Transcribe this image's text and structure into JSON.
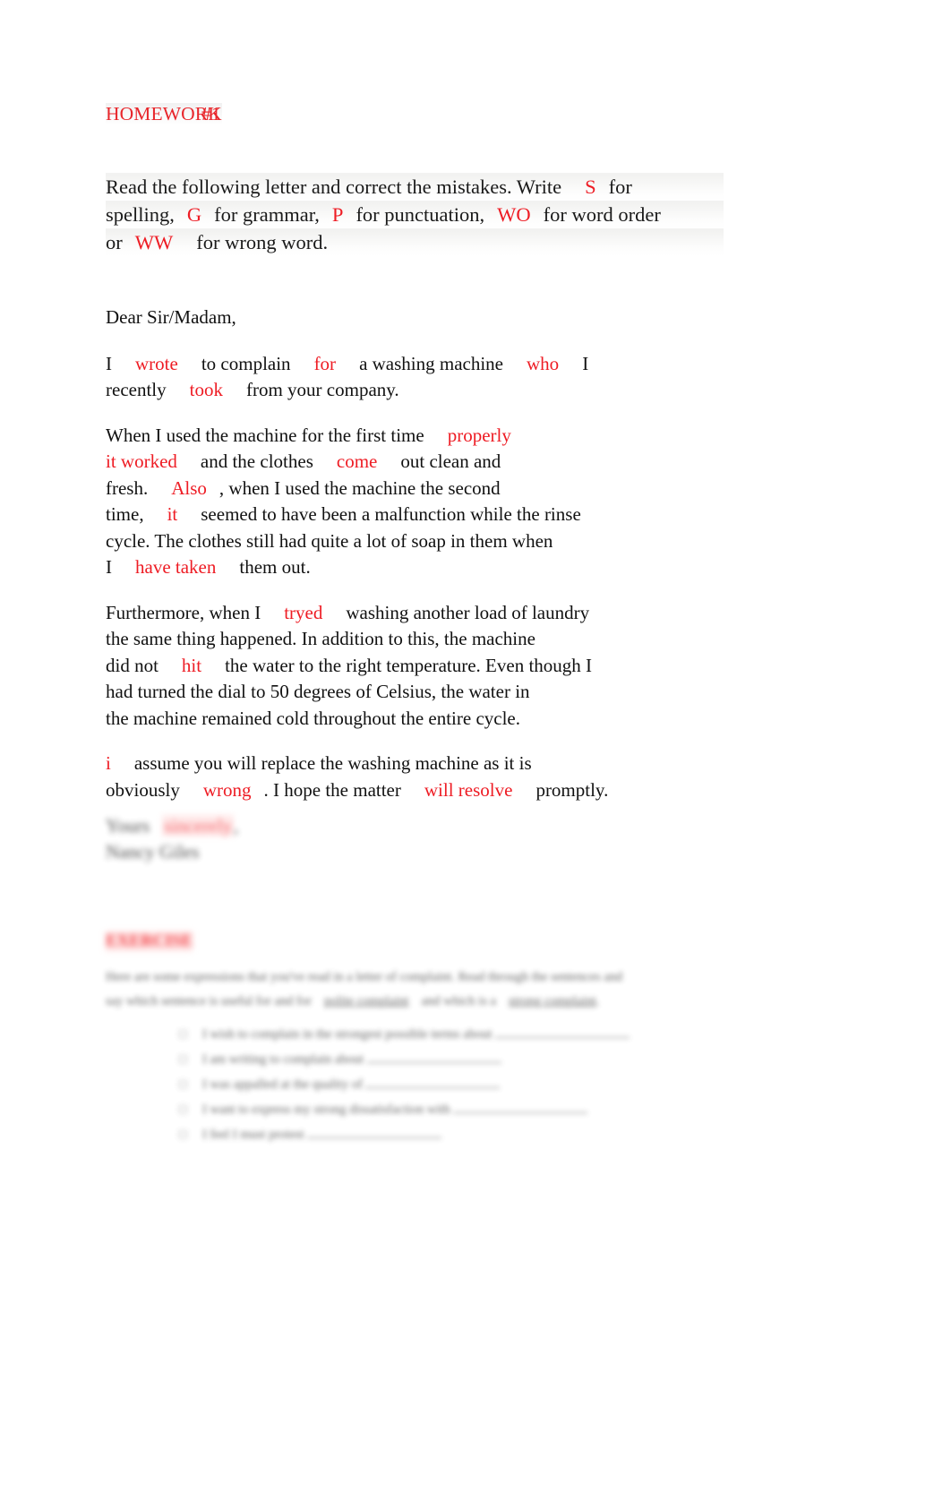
{
  "document": {
    "title_main": "HOMEWORK",
    "title_number": "#1",
    "instructions": {
      "line1_a": "Read the following letter and correct the mistakes. Write",
      "line1_code": "S",
      "line1_b": "for",
      "line2_a": "spelling,",
      "line2_code1": "G",
      "line2_b": "for grammar,",
      "line2_code2": "P",
      "line2_c": "for punctuation,",
      "line2_code3": "WO",
      "line2_d": "for word order",
      "line3_a": "or",
      "line3_code": "WW",
      "line3_b": "for wrong word."
    },
    "salutation": "Dear Sir/Madam,",
    "paragraphs": [
      {
        "id": "p1",
        "lines": [
          [
            {
              "t": "I",
              "c": "black"
            },
            {
              "t": "wrote",
              "c": "red"
            },
            {
              "t": "to complain",
              "c": "black"
            },
            {
              "t": "for",
              "c": "red"
            },
            {
              "t": "a washing machine",
              "c": "black"
            },
            {
              "t": "who",
              "c": "red"
            },
            {
              "t": "I",
              "c": "black"
            }
          ],
          [
            {
              "t": "recently",
              "c": "black"
            },
            {
              "t": "took",
              "c": "red"
            },
            {
              "t": "from your company.",
              "c": "black"
            }
          ]
        ]
      },
      {
        "id": "p2",
        "lines": [
          [
            {
              "t": "When I used the machine for the first time",
              "c": "black"
            },
            {
              "t": "properly",
              "c": "red"
            }
          ],
          [
            {
              "t": "it worked",
              "c": "red"
            },
            {
              "t": "and the clothes",
              "c": "black"
            },
            {
              "t": "come",
              "c": "red"
            },
            {
              "t": "out clean and",
              "c": "black"
            }
          ],
          [
            {
              "t": "fresh.",
              "c": "black"
            },
            {
              "t": "Also",
              "c": "red"
            },
            {
              "t": ", when I used the machine the second",
              "c": "black"
            }
          ],
          [
            {
              "t": "time,",
              "c": "black"
            },
            {
              "t": "it",
              "c": "red"
            },
            {
              "t": "seemed to have been a malfunction while the rinse",
              "c": "black"
            }
          ],
          [
            {
              "t": "cycle. The clothes still had quite a lot of soap in them when",
              "c": "black"
            }
          ],
          [
            {
              "t": "I",
              "c": "black"
            },
            {
              "t": "have taken",
              "c": "red"
            },
            {
              "t": "them out.",
              "c": "black"
            }
          ]
        ]
      },
      {
        "id": "p3",
        "lines": [
          [
            {
              "t": "Furthermore, when I",
              "c": "black"
            },
            {
              "t": "tryed",
              "c": "red"
            },
            {
              "t": "washing another load of laundry",
              "c": "black"
            }
          ],
          [
            {
              "t": "the same thing happened. In addition to this, the machine",
              "c": "black"
            }
          ],
          [
            {
              "t": "did not",
              "c": "black"
            },
            {
              "t": "hit",
              "c": "red"
            },
            {
              "t": "the water to the right temperature. Even though I",
              "c": "black"
            }
          ],
          [
            {
              "t": "had turned the dial to 50 degrees of Celsius, the water in",
              "c": "black"
            }
          ],
          [
            {
              "t": "the machine remained cold throughout the entire cycle.",
              "c": "black"
            }
          ]
        ]
      },
      {
        "id": "p4",
        "lines": [
          [
            {
              "t": "i",
              "c": "red"
            },
            {
              "t": "assume you will replace the washing machine as it is",
              "c": "black"
            }
          ],
          [
            {
              "t": "obviously",
              "c": "black"
            },
            {
              "t": "wrong",
              "c": "red"
            },
            {
              "t": ". I hope the matter",
              "c": "black"
            },
            {
              "t": "will resolve",
              "c": "red"
            },
            {
              "t": "promptly.",
              "c": "black"
            }
          ]
        ]
      }
    ],
    "signature": {
      "closing_label": "Yours",
      "closing_highlight": "sincerely",
      "closing_tail": ",",
      "name": "Nancy Giles"
    },
    "exercise": {
      "heading": "EXERCISE",
      "intro_line1": "Here are some expressions that you've read in a letter of complaint. Read through the sentences and",
      "intro_line2_a": "say which sentence is useful for and for",
      "intro_line2_ul1": "polite complaint",
      "intro_line2_b": "and which is a",
      "intro_line2_ul2": "strong complaint",
      "intro_line2_c": ".",
      "items": [
        "I wish to complain in the strongest possible terms about",
        "I am writing to complain about",
        "I was appalled at the quality of",
        "I want to express my strong dissatisfaction with",
        "I feel I must protest"
      ]
    }
  },
  "colors": {
    "correction_red": "#ee1c24",
    "title_red": "#e8262b",
    "body_black": "#111111"
  }
}
